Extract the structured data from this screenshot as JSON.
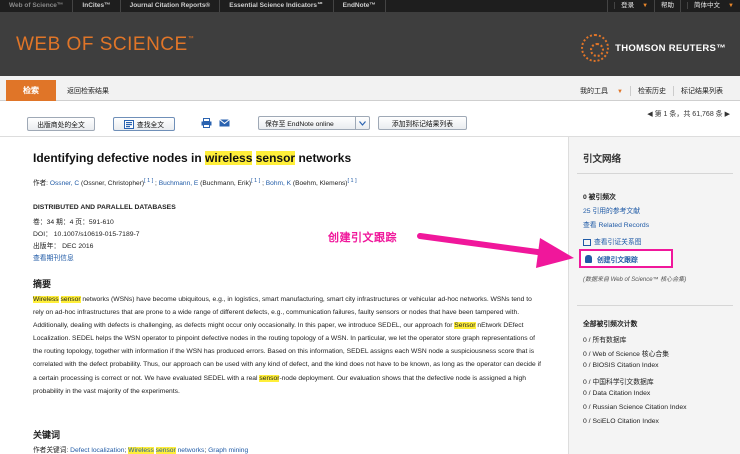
{
  "topbar": {
    "products": [
      "Web of Science™",
      "InCites™",
      "Journal Citation Reports®",
      "Essential Science Indicators℠",
      "EndNote™"
    ],
    "login": "登录",
    "help": "帮助",
    "language": "简体中文"
  },
  "banner": {
    "brand": "WEB OF SCIENCE",
    "brand_tm": "™",
    "publisher": "THOMSON REUTERS™"
  },
  "nav": {
    "search_tab": "检索",
    "back": "返回检索结果",
    "my_tools": "我的工具",
    "history": "检索历史",
    "marked_list": "标记结果列表"
  },
  "toolbar": {
    "publisher_fulltext": "出版商处的全文",
    "find_fulltext": "查找全文",
    "save_to": "保存至 EndNote online",
    "add_to_marked": "添加到标记结果列表",
    "pager": "◀ 第 1 条，共 61,768 条 ▶"
  },
  "record": {
    "title_pre": "Identifying defective nodes in ",
    "title_hl1": "wireless",
    "title_hl2": "sensor",
    "title_post": " networks",
    "authors_label": "作者: ",
    "author1": "Ossner, C",
    "author1_full": " (Ossner, Christopher)",
    "author1_ref": "[ 1 ]",
    "author2": "Buchmann, E",
    "author2_full": " (Buchmann, Erik)",
    "author2_ref": "[ 1 ]",
    "author3": "Bohm, K",
    "author3_full": " (Boehm, Klemens)",
    "author3_ref": "[ 1 ]",
    "journal": "DISTRIBUTED AND PARALLEL DATABASES",
    "volume_line": "卷：34   期：4   页：591-610",
    "doi_line": "DOI： 10.1007/s10619-015-7189-7",
    "year_line": "出版年：  DEC 2016",
    "journal_info": "查看期刊信息",
    "abstract_heading": "摘要",
    "abstract_hl_a": "Wireless",
    "abstract_hl_b": "sensor",
    "abstract_1": " networks (WSNs) have become ubiquitous, e.g., in logistics, smart manufacturing, smart city infrastructures or vehicular ad-hoc networks. WSNs tend to rely on ad-hoc infrastructures that are prone to a wide range of different defects, e.g., communication failures, faulty sensors or nodes that have been tampered with. Additionally, dealing with defects is challenging, as defects might occur only occasionally. In this paper, we introduce SEDEL, our approach for ",
    "abstract_hl_c": "Sensor",
    "abstract_2": " nEtwork DEfect Localization. SEDEL helps the WSN operator to pinpoint defective nodes in the routing topology of a WSN. In particular, we let the operator store graph representations of the routing topology, together with information if the WSN has produced errors. Based on this information, SEDEL assigns each WSN node a suspiciousness score that is correlated with the defect probability. Thus, our approach can be used with any kind of defect, and the kind does not have to be known, as long as the operator can decide if a certain processing is correct or not. We have evaluated SEDEL with a real ",
    "abstract_hl_d": "sensor",
    "abstract_3": "-node deployment. Our evaluation shows that the defective node is assigned a high probability in the vast majority of the experiments.",
    "keywords_heading": "关键词",
    "keywords_label": "作者关键词: ",
    "kw1": "Defect localization",
    "kw2a": "Wireless",
    "kw2b": "sensor",
    "kw2c": " networks",
    "kw3": "Graph mining"
  },
  "sidebar": {
    "title": "引文网络",
    "times_cited": "0 被引频次",
    "references": "25 引用的参考文献",
    "related": "查看 Related Records",
    "citation_map": "查看引证关系图",
    "create_alert": "创建引文跟踪",
    "source_note": "(数据来自 Web of Science™ 核心合集)",
    "all_counts_title": "全部被引频次计数",
    "counts": [
      "0 / 所有数据库",
      "0 / Web of Science 核心合集",
      "0 / BIOSIS Citation Index",
      "0 / 中国科学引文数据库",
      "0 / Data Citation Index",
      "0 / Russian Science Citation Index",
      "0 / SciELO Citation Index"
    ]
  },
  "annotation": {
    "label": "创建引文跟踪",
    "color": "#f0179b"
  },
  "colors": {
    "accent": "#e07528",
    "link": "#1f5aa6",
    "highlight": "#ffef3a"
  }
}
